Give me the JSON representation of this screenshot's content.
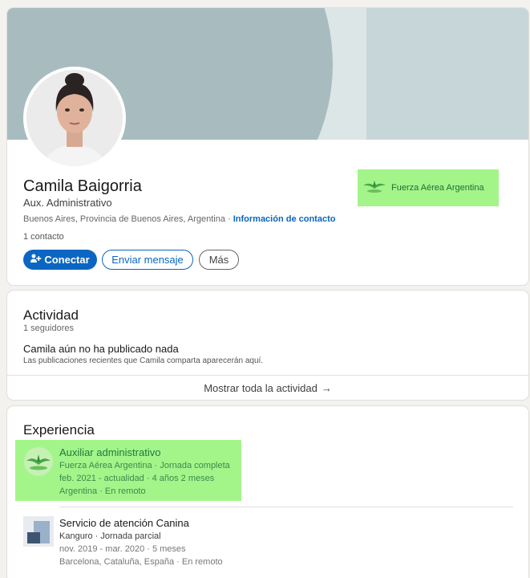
{
  "profile": {
    "name": "Camila Baigorria",
    "headline": "Aux. Administrativo",
    "location": "Buenos Aires, Provincia de Buenos Aires, Argentina",
    "separator": " · ",
    "contact_info_label": "Información de contacto",
    "connections": "1 contacto",
    "current_company": "Fuerza Aérea Argentina",
    "buttons": {
      "connect": "Conectar",
      "message": "Enviar mensaje",
      "more": "Más"
    }
  },
  "activity": {
    "title": "Actividad",
    "followers": "1 seguidores",
    "empty_title": "Camila aún no ha publicado nada",
    "empty_subtitle": "Las publicaciones recientes que Camila comparta aparecerán aquí.",
    "show_all": "Mostrar toda la actividad",
    "show_all_arrow": "→"
  },
  "experience": {
    "title": "Experiencia",
    "items": [
      {
        "title": "Auxiliar administrativo",
        "company_line": "Fuerza Aérea Argentina · Jornada completa",
        "dates": "feb. 2021 - actualidad · 4 años 2 meses",
        "location": "Argentina · En remoto"
      },
      {
        "title": "Servicio de atención Canina",
        "company_line": "Kanguro · Jornada parcial",
        "dates": "nov. 2019 - mar. 2020 · 5 meses",
        "location": "Barcelona, Cataluña, España · En remoto"
      }
    ]
  },
  "colors": {
    "primary": "#0a66c2",
    "highlight": "#a3f58a",
    "background": "#f3f2ef"
  },
  "icons": {
    "connect": "add-person-icon",
    "arrow": "arrow-right-icon",
    "company_logo": "fuerza-aerea-logo-icon"
  }
}
